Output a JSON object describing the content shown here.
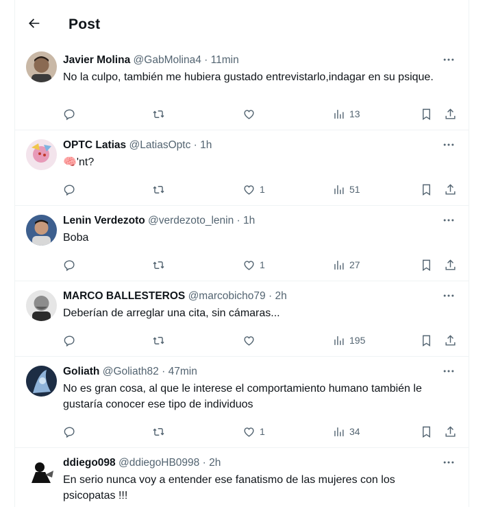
{
  "header": {
    "title": "Post",
    "back_icon": "arrow-left-icon"
  },
  "replies": [
    {
      "name": "Javier Molina",
      "handle": "@GabMolina4",
      "dot": "·",
      "time": "11min",
      "text": "No la culpo, también me hubiera gustado entrevistarlo,indagar en su psique.",
      "likes": "",
      "views": "13",
      "avatar_color": "#6b5a4a"
    },
    {
      "name": "OPTC Latias",
      "handle": "@LatiasOptc",
      "dot": "·",
      "time": "1h",
      "text": "🧠'nt?",
      "likes": "1",
      "views": "51",
      "avatar_color": "#e9b7c9"
    },
    {
      "name": "Lenin Verdezoto",
      "handle": "@verdezoto_lenin",
      "dot": "·",
      "time": "1h",
      "text": "Boba",
      "likes": "1",
      "views": "27",
      "avatar_color": "#2f4f7a"
    },
    {
      "name": "MARCO BALLESTEROS",
      "handle": "@marcobicho79",
      "dot": "·",
      "time": "2h",
      "text": "Deberían de arreglar una cita, sin cámaras...",
      "likes": "",
      "views": "195",
      "avatar_color": "#7d7d7d"
    },
    {
      "name": "Goliath",
      "handle": "@Goliath82",
      "dot": "·",
      "time": "47min",
      "text": "No es gran cosa, al que le interese el comportamiento humano también  le gustaría conocer ese tipo de individuos",
      "likes": "1",
      "views": "34",
      "avatar_color": "#3e5a7d"
    },
    {
      "name": "ddiego098",
      "handle": "@ddiegoHB0998",
      "dot": "·",
      "time": "2h",
      "text": "En serio nunca voy a entender ese fanatismo de las mujeres con los psicopatas !!!",
      "likes": "",
      "views": "",
      "avatar_color": "#222222"
    }
  ]
}
